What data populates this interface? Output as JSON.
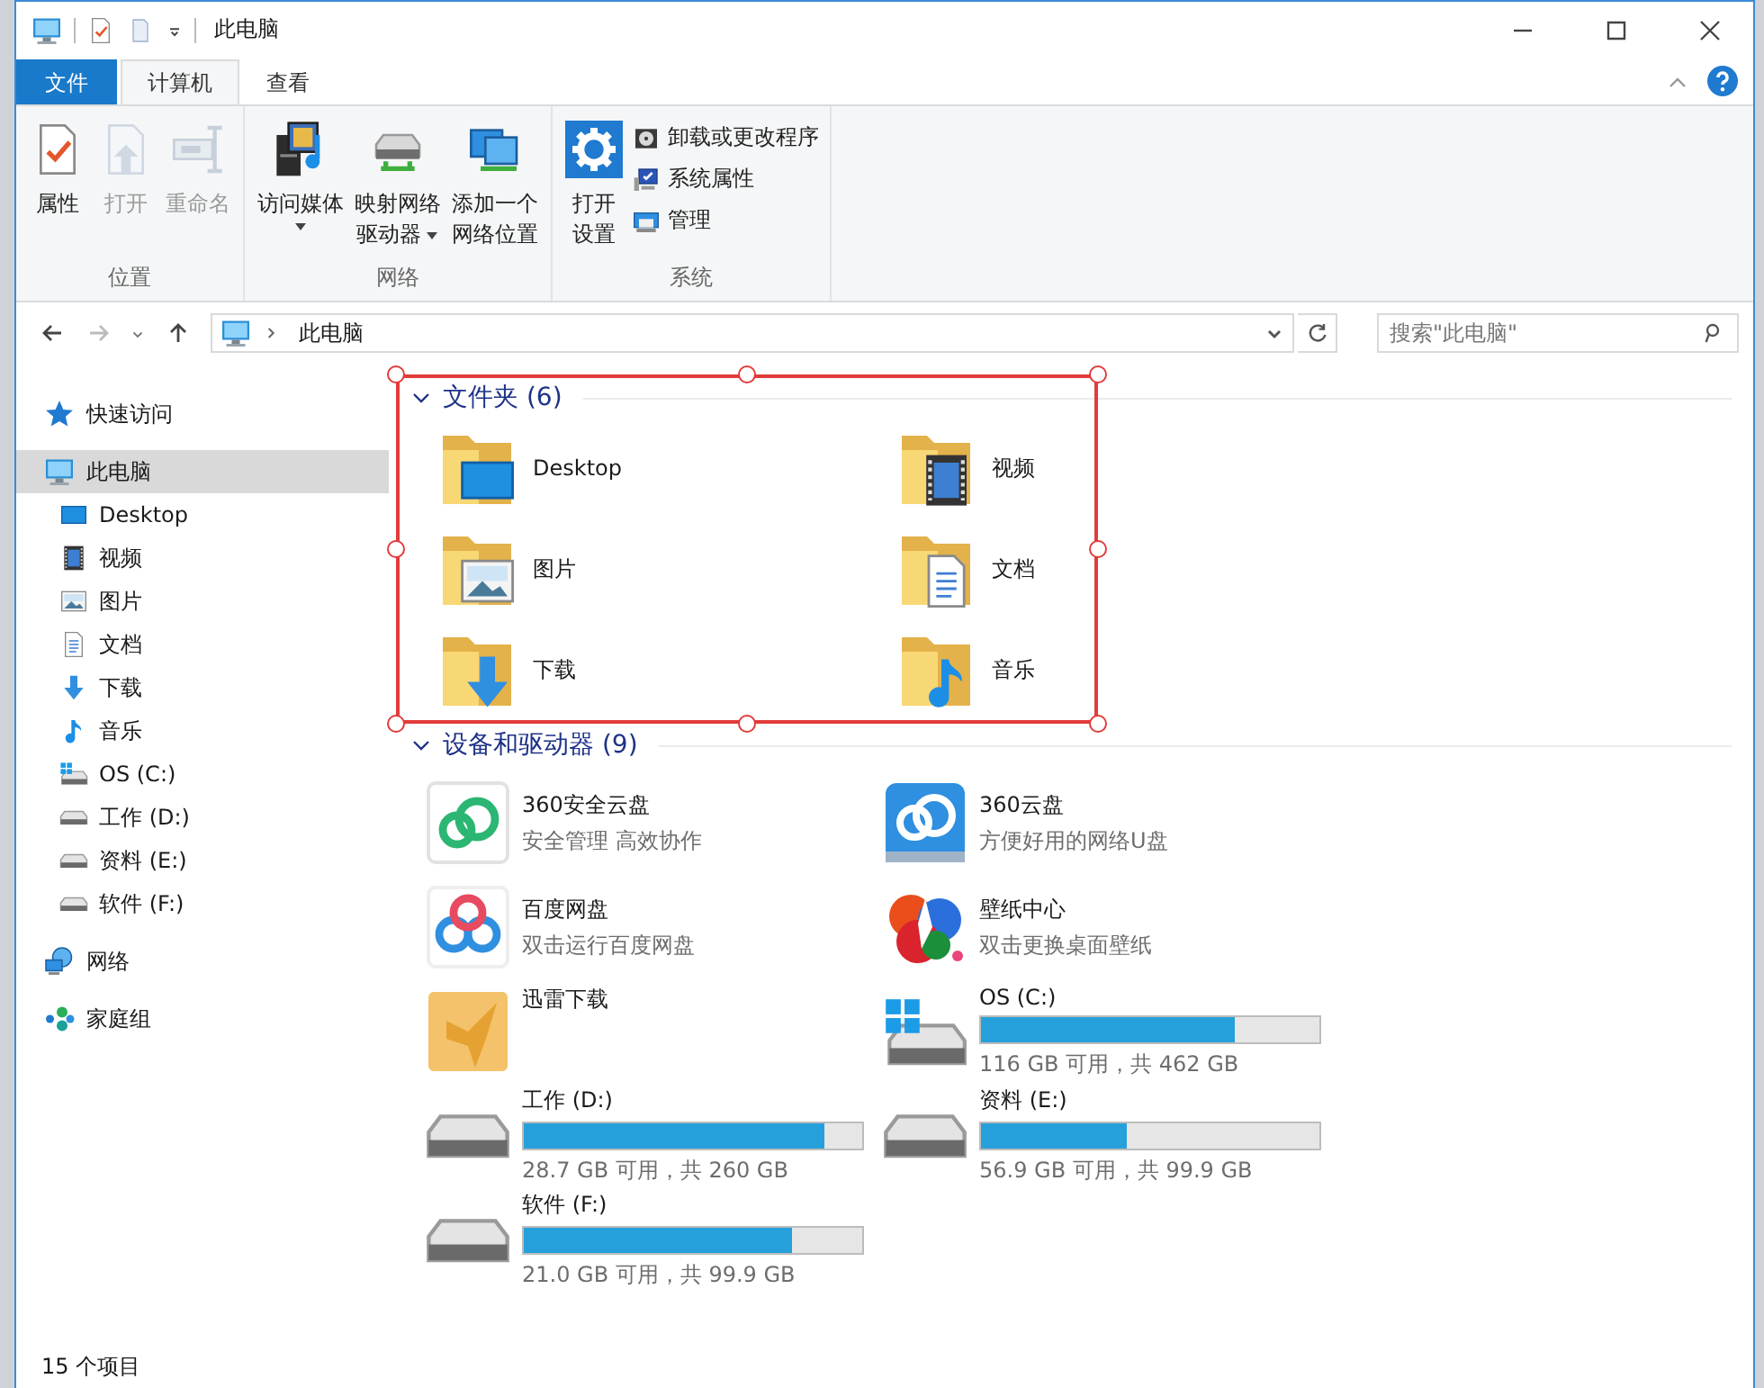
{
  "window": {
    "title": "此电脑"
  },
  "ribbon_tabs": [
    {
      "label": "文件",
      "kind": "file",
      "selected": false
    },
    {
      "label": "计算机",
      "kind": "tab",
      "selected": true
    },
    {
      "label": "查看",
      "kind": "tab",
      "selected": false
    }
  ],
  "ribbon_groups": [
    {
      "label": "位置",
      "buttons": [
        {
          "lines": [
            "属性"
          ],
          "disabled": false,
          "dropdown": false
        },
        {
          "lines": [
            "打开"
          ],
          "disabled": true,
          "dropdown": false
        },
        {
          "lines": [
            "重命名"
          ],
          "disabled": true,
          "dropdown": false
        }
      ]
    },
    {
      "label": "网络",
      "buttons": [
        {
          "lines": [
            "访问媒体"
          ],
          "disabled": false,
          "dropdown": true
        },
        {
          "lines": [
            "映射网络",
            "驱动器"
          ],
          "disabled": false,
          "dropdown": true
        },
        {
          "lines": [
            "添加一个",
            "网络位置"
          ],
          "disabled": false,
          "dropdown": false
        }
      ]
    },
    {
      "label": "系统",
      "buttons": [
        {
          "lines": [
            "打开",
            "设置"
          ],
          "disabled": false,
          "dropdown": false
        }
      ],
      "small_buttons": [
        {
          "label": "卸载或更改程序"
        },
        {
          "label": "系统属性"
        },
        {
          "label": "管理"
        }
      ]
    }
  ],
  "address": {
    "path": "此电脑"
  },
  "search": {
    "placeholder": "搜索\"此电脑\""
  },
  "nav": [
    {
      "label": "快速访问",
      "selected": false
    },
    {
      "label": "此电脑",
      "selected": true,
      "children": [
        {
          "label": "Desktop",
          "selected": false
        },
        {
          "label": "视频",
          "selected": false
        },
        {
          "label": "图片",
          "selected": false
        },
        {
          "label": "文档",
          "selected": false
        },
        {
          "label": "下载",
          "selected": false
        },
        {
          "label": "音乐",
          "selected": false
        },
        {
          "label": "OS (C:)",
          "selected": false
        },
        {
          "label": "工作 (D:)",
          "selected": false
        },
        {
          "label": "资料 (E:)",
          "selected": false
        },
        {
          "label": "软件 (F:)",
          "selected": false
        }
      ]
    },
    {
      "label": "网络",
      "selected": false
    },
    {
      "label": "家庭组",
      "selected": false
    }
  ],
  "folders_section": {
    "title": "文件夹 (6)",
    "expanded": true,
    "items": [
      {
        "name": "Desktop"
      },
      {
        "name": "视频"
      },
      {
        "name": "图片"
      },
      {
        "name": "文档"
      },
      {
        "name": "下载"
      },
      {
        "name": "音乐"
      }
    ]
  },
  "devices_section": {
    "title": "设备和驱动器 (9)",
    "expanded": true,
    "items": [
      {
        "kind": "app",
        "name": "360安全云盘",
        "detail": "安全管理 高效协作"
      },
      {
        "kind": "app",
        "name": "360云盘",
        "detail": "方便好用的网络U盘"
      },
      {
        "kind": "app",
        "name": "百度网盘",
        "detail": "双击运行百度网盘"
      },
      {
        "kind": "app",
        "name": "壁纸中心",
        "detail": "双击更换桌面壁纸"
      },
      {
        "kind": "shortcut",
        "name": "迅雷下载"
      },
      {
        "kind": "drive",
        "name": "OS (C:)",
        "level": 0.75,
        "reading": "116 GB 可用，共 462 GB"
      },
      {
        "kind": "drive",
        "name": "工作 (D:)",
        "level": 0.89,
        "reading": "28.7 GB 可用，共 260 GB"
      },
      {
        "kind": "drive",
        "name": "资料 (E:)",
        "level": 0.43,
        "reading": "56.9 GB 可用，共 99.9 GB"
      },
      {
        "kind": "drive",
        "name": "软件 (F:)",
        "level": 0.79,
        "reading": "21.0 GB 可用，共 99.9 GB"
      }
    ]
  },
  "status_bar": {
    "text": "15 个项目"
  }
}
